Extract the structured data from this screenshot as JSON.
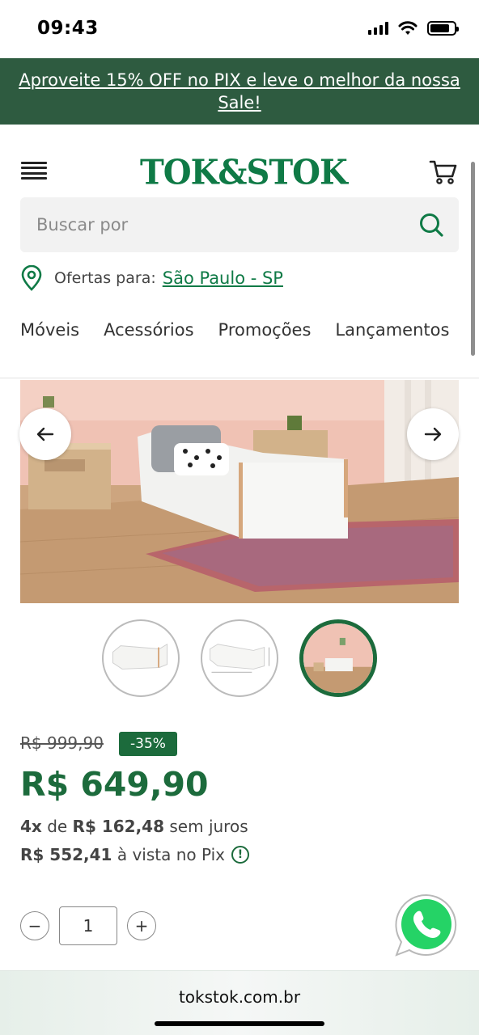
{
  "status_bar": {
    "time": "09:43"
  },
  "promo": {
    "text": "Aproveite 15% OFF no PIX e leve o melhor da nossa Sale!"
  },
  "header": {
    "logo": "TOK&STOK",
    "search_placeholder": "Buscar por",
    "location_label": "Ofertas para:",
    "location_value": "São Paulo - SP",
    "nav": [
      "Móveis",
      "Acessórios",
      "Promoções",
      "Lançamentos"
    ]
  },
  "product": {
    "old_price": "R$ 999,90",
    "discount": "-35%",
    "price": "R$ 649,90",
    "installments_count": "4x",
    "installments_of": "de",
    "installments_value": "R$ 162,48",
    "installments_suffix": "sem juros",
    "pix_value": "R$ 552,41",
    "pix_suffix": "à vista no Pix",
    "quantity": "1"
  },
  "gallery": {
    "thumbnails": 3,
    "active_index": 2
  },
  "browser": {
    "url": "tokstok.com.br"
  },
  "colors": {
    "brand_green": "#0f7a46",
    "banner_green": "#2e5b40",
    "price_green": "#1c6b3c",
    "whatsapp": "#25d366"
  }
}
